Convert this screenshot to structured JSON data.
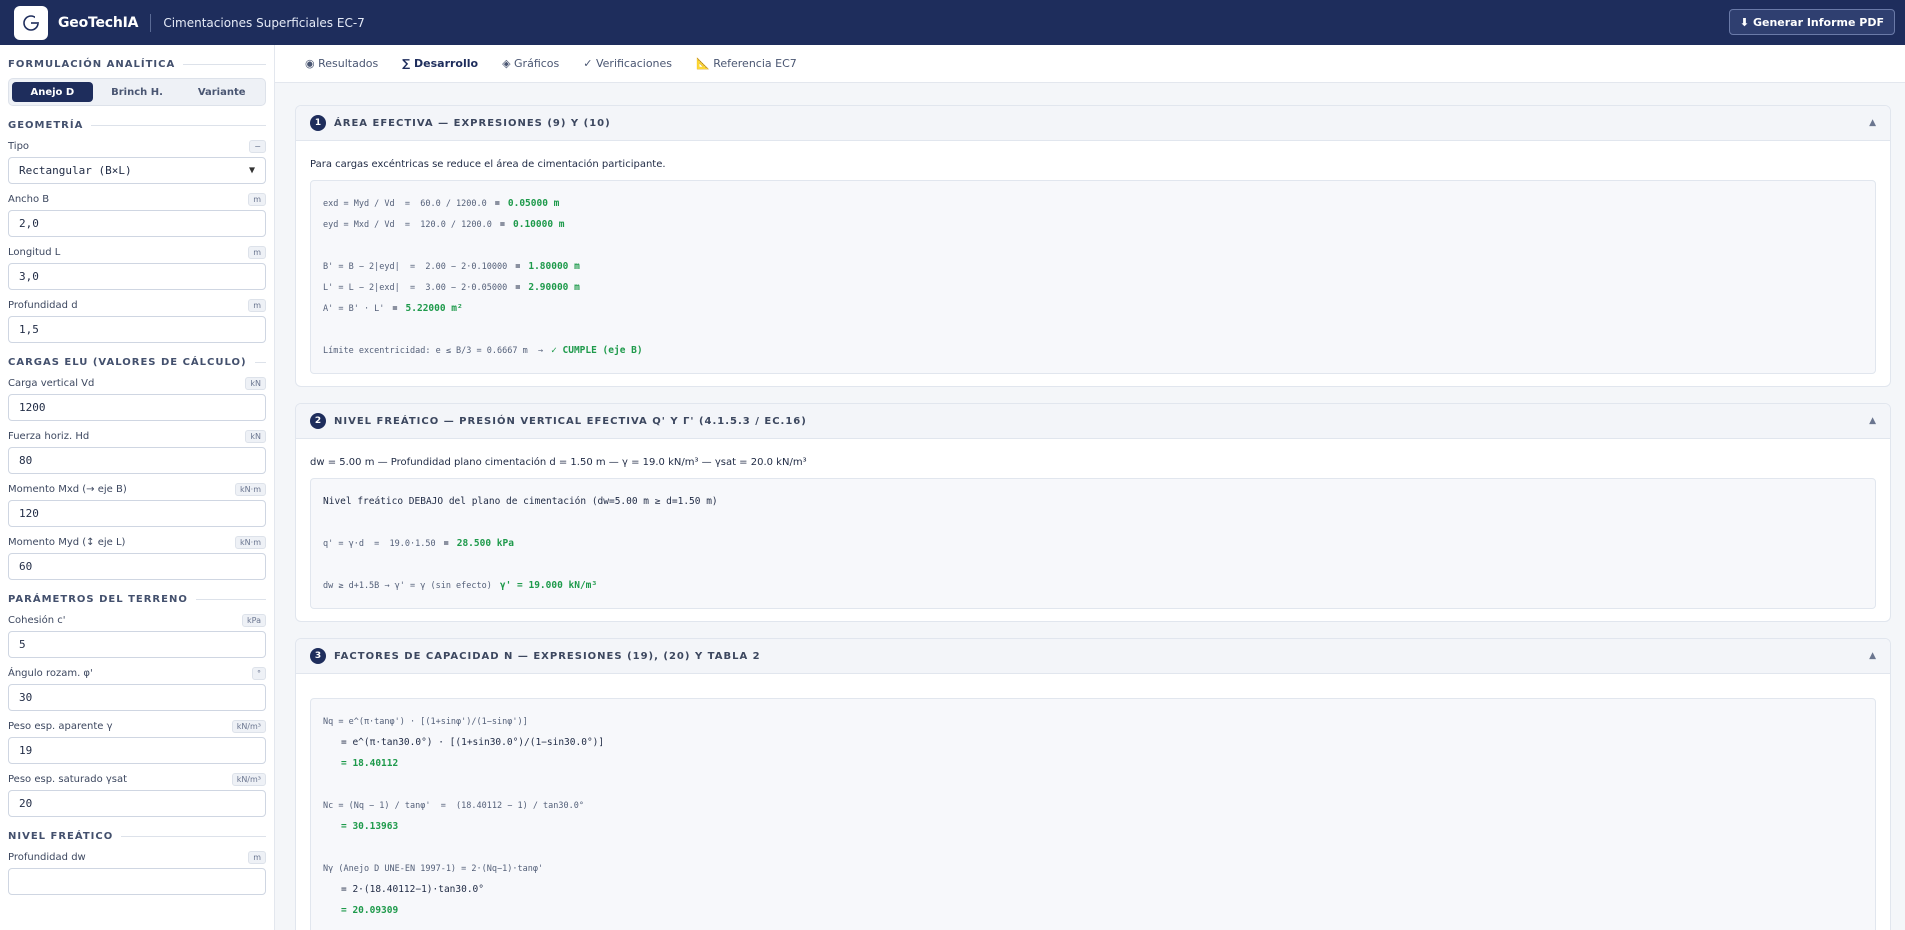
{
  "header": {
    "brand": "GeoTechIA",
    "title": "Cimentaciones Superficiales EC-7",
    "pdf_button": "⬇ Generar Informe PDF"
  },
  "sidebar": {
    "formulacion_title": "FORMULACIÓN ANALÍTICA",
    "formulacion_options": [
      "Anejo D",
      "Brinch H.",
      "Variante"
    ],
    "geometria_title": "GEOMETRÍA",
    "tipo_label": "Tipo",
    "tipo_unit": "−",
    "tipo_value": "Rectangular (B×L)",
    "ancho_label": "Ancho B",
    "ancho_unit": "m",
    "ancho_value": "2,0",
    "longitud_label": "Longitud L",
    "longitud_unit": "m",
    "longitud_value": "3,0",
    "profundidad_label": "Profundidad d",
    "profundidad_unit": "m",
    "profundidad_value": "1,5",
    "cargas_title": "CARGAS ELU (VALORES DE CÁLCULO)",
    "vd_label": "Carga vertical Vd",
    "vd_unit": "kN",
    "vd_value": "1200",
    "hd_label": "Fuerza horiz. Hd",
    "hd_unit": "kN",
    "hd_value": "80",
    "mxd_label": "Momento Mxd (→ eje B)",
    "mxd_unit": "kN·m",
    "mxd_value": "120",
    "myd_label": "Momento Myd (↕ eje L)",
    "myd_unit": "kN·m",
    "myd_value": "60",
    "terreno_title": "PARÁMETROS DEL TERRENO",
    "cohesion_label": "Cohesión c'",
    "cohesion_unit": "kPa",
    "cohesion_value": "5",
    "angulo_label": "Ángulo rozam. φ'",
    "angulo_unit": "°",
    "angulo_value": "30",
    "peso_ap_label": "Peso esp. aparente γ",
    "peso_ap_unit": "kN/m³",
    "peso_ap_value": "19",
    "peso_sat_label": "Peso esp. saturado γsat",
    "peso_sat_unit": "kN/m³",
    "peso_sat_value": "20",
    "freatico_title": "NIVEL FREÁTICO",
    "dw_label": "Profundidad dw",
    "dw_unit": "m"
  },
  "tabs": [
    "◉ Resultados",
    "∑ Desarrollo",
    "◈ Gráficos",
    "✓ Verificaciones",
    "📐 Referencia EC7"
  ],
  "card1": {
    "num": "1",
    "title": "ÁREA EFECTIVA — EXPRESIONES (9) Y (10)",
    "intro": "Para cargas excéntricas se reduce el área de cimentación participante.",
    "exd_expr": "exd = Myd / Vd  =  60.0 / 1200.0",
    "exd_res": "0.05000 m",
    "eyd_expr": "eyd = Mxd / Vd  =  120.0 / 1200.0",
    "eyd_res": "0.10000 m",
    "b_expr": "B' = B − 2|eyd|  =  2.00 − 2·0.10000",
    "b_res": "1.80000 m",
    "l_expr": "L' = L − 2|exd|  =  3.00 − 2·0.05000",
    "l_res": "2.90000 m",
    "a_expr": "A' = B' · L'",
    "a_res": "5.22000 m²",
    "lim_expr": "Límite excentricidad: e ≤ B/3 = 0.6667 m  →",
    "lim_res": "✓ CUMPLE (eje B)",
    "eq": "="
  },
  "card2": {
    "num": "2",
    "title": "NIVEL FREÁTICO — PRESIÓN VERTICAL EFECTIVA Q' Y Γ' (4.1.5.3 / EC.16)",
    "intro": "dw = 5.00 m — Profundidad plano cimentación d = 1.50 m — γ = 19.0 kN/m³ — γsat = 20.0 kN/m³",
    "status": "Nivel freático DEBAJO del plano de cimentación (dw=5.00 m ≥ d=1.50 m)",
    "q_expr": "q' = γ·d  =  19.0·1.50",
    "q_res": "28.500 kPa",
    "g_expr": "dw ≥ d+1.5B → γ' = γ (sin efecto)",
    "g_res": "γ' = 19.000 kN/m³"
  },
  "card3": {
    "num": "3",
    "title": "FACTORES DE CAPACIDAD N — EXPRESIONES (19), (20) Y TABLA 2",
    "nq_expr": "Nq = e^(π·tanφ') · [(1+sinφ')/(1−sinφ')]",
    "nq_sub": "= e^(π·tan30.0°) · [(1+sin30.0°)/(1−sin30.0°)]",
    "nq_res": "= 18.40112",
    "nc_expr": "Nc = (Nq − 1) / tanφ'  =  (18.40112 − 1) / tan30.0°",
    "nc_res": "= 30.13963",
    "ng_expr": "Nγ (Anejo D UNE-EN 1997-1) = 2·(Nq−1)·tanφ'",
    "ng_sub": "= 2·(18.40112−1)·tan30.0°",
    "ng_res": "= 20.09309"
  },
  "colors": {
    "navy": "#1e2d5c",
    "green": "#1e9a4b"
  }
}
